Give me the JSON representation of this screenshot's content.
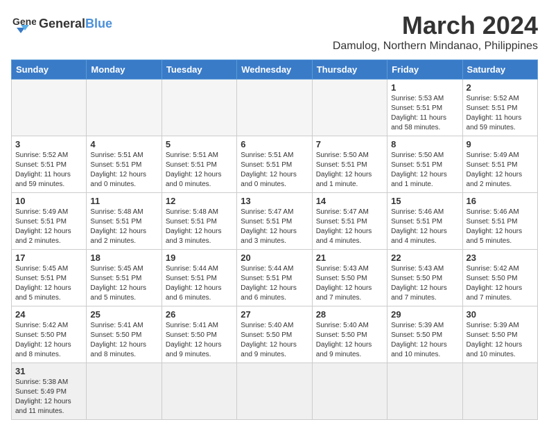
{
  "header": {
    "logo_text_general": "General",
    "logo_text_blue": "Blue",
    "main_title": "March 2024",
    "subtitle": "Damulog, Northern Mindanao, Philippines"
  },
  "calendar": {
    "days_of_week": [
      "Sunday",
      "Monday",
      "Tuesday",
      "Wednesday",
      "Thursday",
      "Friday",
      "Saturday"
    ],
    "weeks": [
      [
        {
          "day": "",
          "info": ""
        },
        {
          "day": "",
          "info": ""
        },
        {
          "day": "",
          "info": ""
        },
        {
          "day": "",
          "info": ""
        },
        {
          "day": "",
          "info": ""
        },
        {
          "day": "1",
          "info": "Sunrise: 5:53 AM\nSunset: 5:51 PM\nDaylight: 11 hours and 58 minutes."
        },
        {
          "day": "2",
          "info": "Sunrise: 5:52 AM\nSunset: 5:51 PM\nDaylight: 11 hours and 59 minutes."
        }
      ],
      [
        {
          "day": "3",
          "info": "Sunrise: 5:52 AM\nSunset: 5:51 PM\nDaylight: 11 hours and 59 minutes."
        },
        {
          "day": "4",
          "info": "Sunrise: 5:51 AM\nSunset: 5:51 PM\nDaylight: 12 hours and 0 minutes."
        },
        {
          "day": "5",
          "info": "Sunrise: 5:51 AM\nSunset: 5:51 PM\nDaylight: 12 hours and 0 minutes."
        },
        {
          "day": "6",
          "info": "Sunrise: 5:51 AM\nSunset: 5:51 PM\nDaylight: 12 hours and 0 minutes."
        },
        {
          "day": "7",
          "info": "Sunrise: 5:50 AM\nSunset: 5:51 PM\nDaylight: 12 hours and 1 minute."
        },
        {
          "day": "8",
          "info": "Sunrise: 5:50 AM\nSunset: 5:51 PM\nDaylight: 12 hours and 1 minute."
        },
        {
          "day": "9",
          "info": "Sunrise: 5:49 AM\nSunset: 5:51 PM\nDaylight: 12 hours and 2 minutes."
        }
      ],
      [
        {
          "day": "10",
          "info": "Sunrise: 5:49 AM\nSunset: 5:51 PM\nDaylight: 12 hours and 2 minutes."
        },
        {
          "day": "11",
          "info": "Sunrise: 5:48 AM\nSunset: 5:51 PM\nDaylight: 12 hours and 2 minutes."
        },
        {
          "day": "12",
          "info": "Sunrise: 5:48 AM\nSunset: 5:51 PM\nDaylight: 12 hours and 3 minutes."
        },
        {
          "day": "13",
          "info": "Sunrise: 5:47 AM\nSunset: 5:51 PM\nDaylight: 12 hours and 3 minutes."
        },
        {
          "day": "14",
          "info": "Sunrise: 5:47 AM\nSunset: 5:51 PM\nDaylight: 12 hours and 4 minutes."
        },
        {
          "day": "15",
          "info": "Sunrise: 5:46 AM\nSunset: 5:51 PM\nDaylight: 12 hours and 4 minutes."
        },
        {
          "day": "16",
          "info": "Sunrise: 5:46 AM\nSunset: 5:51 PM\nDaylight: 12 hours and 5 minutes."
        }
      ],
      [
        {
          "day": "17",
          "info": "Sunrise: 5:45 AM\nSunset: 5:51 PM\nDaylight: 12 hours and 5 minutes."
        },
        {
          "day": "18",
          "info": "Sunrise: 5:45 AM\nSunset: 5:51 PM\nDaylight: 12 hours and 5 minutes."
        },
        {
          "day": "19",
          "info": "Sunrise: 5:44 AM\nSunset: 5:51 PM\nDaylight: 12 hours and 6 minutes."
        },
        {
          "day": "20",
          "info": "Sunrise: 5:44 AM\nSunset: 5:51 PM\nDaylight: 12 hours and 6 minutes."
        },
        {
          "day": "21",
          "info": "Sunrise: 5:43 AM\nSunset: 5:50 PM\nDaylight: 12 hours and 7 minutes."
        },
        {
          "day": "22",
          "info": "Sunrise: 5:43 AM\nSunset: 5:50 PM\nDaylight: 12 hours and 7 minutes."
        },
        {
          "day": "23",
          "info": "Sunrise: 5:42 AM\nSunset: 5:50 PM\nDaylight: 12 hours and 7 minutes."
        }
      ],
      [
        {
          "day": "24",
          "info": "Sunrise: 5:42 AM\nSunset: 5:50 PM\nDaylight: 12 hours and 8 minutes."
        },
        {
          "day": "25",
          "info": "Sunrise: 5:41 AM\nSunset: 5:50 PM\nDaylight: 12 hours and 8 minutes."
        },
        {
          "day": "26",
          "info": "Sunrise: 5:41 AM\nSunset: 5:50 PM\nDaylight: 12 hours and 9 minutes."
        },
        {
          "day": "27",
          "info": "Sunrise: 5:40 AM\nSunset: 5:50 PM\nDaylight: 12 hours and 9 minutes."
        },
        {
          "day": "28",
          "info": "Sunrise: 5:40 AM\nSunset: 5:50 PM\nDaylight: 12 hours and 9 minutes."
        },
        {
          "day": "29",
          "info": "Sunrise: 5:39 AM\nSunset: 5:50 PM\nDaylight: 12 hours and 10 minutes."
        },
        {
          "day": "30",
          "info": "Sunrise: 5:39 AM\nSunset: 5:50 PM\nDaylight: 12 hours and 10 minutes."
        }
      ],
      [
        {
          "day": "31",
          "info": "Sunrise: 5:38 AM\nSunset: 5:49 PM\nDaylight: 12 hours and 11 minutes."
        },
        {
          "day": "",
          "info": ""
        },
        {
          "day": "",
          "info": ""
        },
        {
          "day": "",
          "info": ""
        },
        {
          "day": "",
          "info": ""
        },
        {
          "day": "",
          "info": ""
        },
        {
          "day": "",
          "info": ""
        }
      ]
    ]
  }
}
